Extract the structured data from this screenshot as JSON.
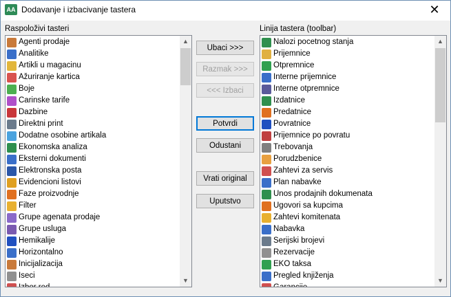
{
  "window": {
    "title": "Dodavanje i izbacivanje tastera",
    "app_icon_text": "AA",
    "close_glyph": "✕"
  },
  "left": {
    "label": "Raspoloživi tasteri",
    "items": [
      {
        "label": "Agenti prodaje",
        "icon": "agents-icon",
        "color": "#c97a3a"
      },
      {
        "label": "Analitike",
        "icon": "analytics-icon",
        "color": "#3a6fc9"
      },
      {
        "label": "Artikli u magacinu",
        "icon": "warehouse-items-icon",
        "color": "#e2b63b"
      },
      {
        "label": "Ažuriranje kartica",
        "icon": "update-cards-icon",
        "color": "#d9534f"
      },
      {
        "label": "Boje",
        "icon": "colors-icon",
        "color": "#4caf50"
      },
      {
        "label": "Carinske tarife",
        "icon": "customs-tariffs-icon",
        "color": "#b04fc9"
      },
      {
        "label": "Dazbine",
        "icon": "duties-icon",
        "color": "#c9363a"
      },
      {
        "label": "Direktni print",
        "icon": "print-icon",
        "color": "#6b7b8c"
      },
      {
        "label": "Dodatne osobine artikala",
        "icon": "attributes-icon",
        "color": "#4aa3df"
      },
      {
        "label": "Ekonomska analiza",
        "icon": "economic-analysis-icon",
        "color": "#2f8f4e"
      },
      {
        "label": "Eksterni dokumenti",
        "icon": "external-docs-icon",
        "color": "#3a6fc9"
      },
      {
        "label": "Elektronska posta",
        "icon": "email-icon",
        "color": "#2b57a8"
      },
      {
        "label": "Evidencioni listovi",
        "icon": "records-icon",
        "color": "#e0a020"
      },
      {
        "label": "Faze proizvodnje",
        "icon": "production-phases-icon",
        "color": "#e07020"
      },
      {
        "label": "Filter",
        "icon": "filter-icon",
        "color": "#e8b030"
      },
      {
        "label": "Grupe agenata prodaje",
        "icon": "agent-groups-icon",
        "color": "#8a6ac9"
      },
      {
        "label": "Grupe usluga",
        "icon": "service-groups-icon",
        "color": "#7a5ab0"
      },
      {
        "label": "Hemikalije",
        "icon": "chemicals-icon",
        "color": "#2050c0"
      },
      {
        "label": "Horizontalno",
        "icon": "horizontal-icon",
        "color": "#3a6fc9"
      },
      {
        "label": "Inicijalizacija",
        "icon": "initialization-icon",
        "color": "#c97a3a"
      },
      {
        "label": "Iseci",
        "icon": "cut-icon",
        "color": "#909090"
      },
      {
        "label": "Izbor red",
        "icon": "select-row-icon",
        "color": "#d05050"
      }
    ]
  },
  "right": {
    "label": "Linija tastera (toolbar)",
    "items": [
      {
        "label": "Nalozi pocetnog stanja",
        "icon": "opening-orders-icon",
        "color": "#2f8f4e"
      },
      {
        "label": "Prijemnice",
        "icon": "receipts-icon",
        "color": "#e0b040"
      },
      {
        "label": "Otpremnice",
        "icon": "dispatch-notes-icon",
        "color": "#30a050"
      },
      {
        "label": "Interne prijemnice",
        "icon": "internal-receipts-icon",
        "color": "#3a6fc9"
      },
      {
        "label": "Interne otpremnice",
        "icon": "internal-dispatch-icon",
        "color": "#5a5a9a"
      },
      {
        "label": "Izdatnice",
        "icon": "issue-notes-icon",
        "color": "#2f8f4e"
      },
      {
        "label": "Predatnice",
        "icon": "handover-notes-icon",
        "color": "#e07020"
      },
      {
        "label": "Povratnice",
        "icon": "return-notes-icon",
        "color": "#2050c0"
      },
      {
        "label": "Prijemnice po povratu",
        "icon": "return-receipts-icon",
        "color": "#c04040"
      },
      {
        "label": "Trebovanja",
        "icon": "requisitions-icon",
        "color": "#808080"
      },
      {
        "label": "Porudzbenice",
        "icon": "orders-icon",
        "color": "#e8a040"
      },
      {
        "label": "Zahtevi za servis",
        "icon": "service-requests-icon",
        "color": "#d05050"
      },
      {
        "label": "Plan nabavke",
        "icon": "procurement-plan-icon",
        "color": "#3a6fc9"
      },
      {
        "label": "Unos prodajnih dokumenata",
        "icon": "sales-docs-icon",
        "color": "#2f8f4e"
      },
      {
        "label": "Ugovori sa kupcima",
        "icon": "contracts-icon",
        "color": "#e07020"
      },
      {
        "label": "Zahtevi komitenata",
        "icon": "client-requests-icon",
        "color": "#e8b030"
      },
      {
        "label": "Nabavka",
        "icon": "procurement-icon",
        "color": "#3a6fc9"
      },
      {
        "label": "Serijski brojevi",
        "icon": "serial-numbers-icon",
        "color": "#6b7b8c"
      },
      {
        "label": "Rezervacije",
        "icon": "reservations-icon",
        "color": "#909090"
      },
      {
        "label": "EKO taksa",
        "icon": "eco-tax-icon",
        "color": "#30a050"
      },
      {
        "label": "Pregled knjiženja",
        "icon": "posting-review-icon",
        "color": "#3a6fc9"
      },
      {
        "label": "Garancije",
        "icon": "warranties-icon",
        "color": "#d05050"
      }
    ]
  },
  "buttons": {
    "insert": "Ubaci  >>>",
    "spacer": "Razmak >>>",
    "remove": "<<< Izbaci",
    "confirm": "Potvrdi",
    "cancel": "Odustani",
    "restore": "Vrati original",
    "help": "Uputstvo"
  }
}
